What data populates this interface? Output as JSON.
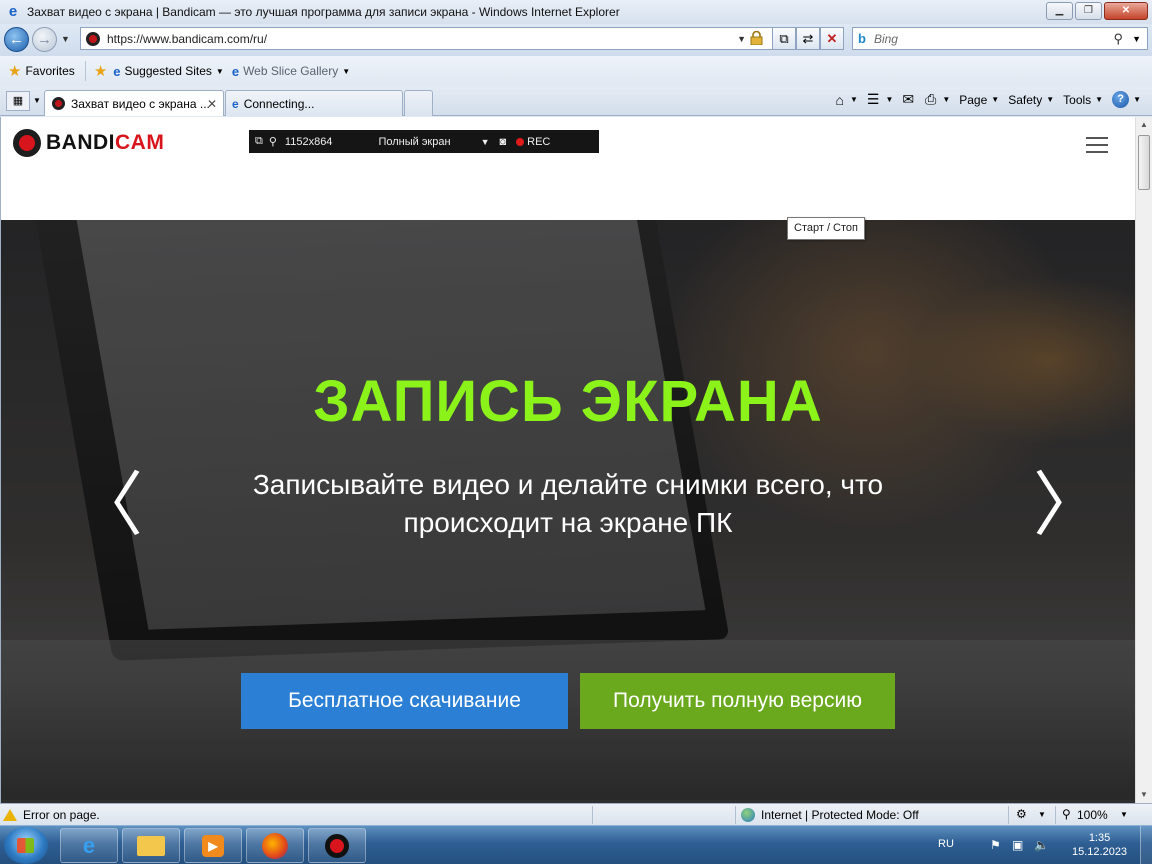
{
  "window": {
    "title": "Захват видео с экрана | Bandicam — это лучшая программа для записи экрана - Windows Internet Explorer",
    "minimize": "▁",
    "maximize": "❐",
    "close": "✕"
  },
  "address": {
    "url": "https://www.bandicam.com/ru/",
    "search_placeholder": "Bing"
  },
  "favorites": {
    "label": "Favorites",
    "items": [
      {
        "label": "Suggested Sites"
      },
      {
        "label": "Web Slice Gallery"
      }
    ]
  },
  "tabs": [
    {
      "label": "Захват видео с экрана ..."
    },
    {
      "label": "Connecting..."
    }
  ],
  "commands": {
    "page": "Page",
    "safety": "Safety",
    "tools": "Tools",
    "help": "?"
  },
  "site": {
    "logo_b": "BANDI",
    "logo_r": "CAM"
  },
  "bandicam_bar": {
    "resolution": "1152x864",
    "mode": "Полный экран",
    "rec": "REC",
    "tooltip": "Старт / Стоп"
  },
  "hero": {
    "title": "ЗАПИСЬ ЭКРАНА",
    "subtitle": "Записывайте видео и делайте снимки всего, что происходит на экране ПК",
    "download_button": "Бесплатное скачивание",
    "full_version_button": "Получить полную версию",
    "prev_arrow": "〈",
    "next_arrow": "〉"
  },
  "status": {
    "error": "Error on page.",
    "zone": "Internet | Protected Mode: Off",
    "zoom": "100%"
  },
  "taskbar": {
    "lang": "RU",
    "time": "1:35",
    "date": "15.12.2023"
  }
}
